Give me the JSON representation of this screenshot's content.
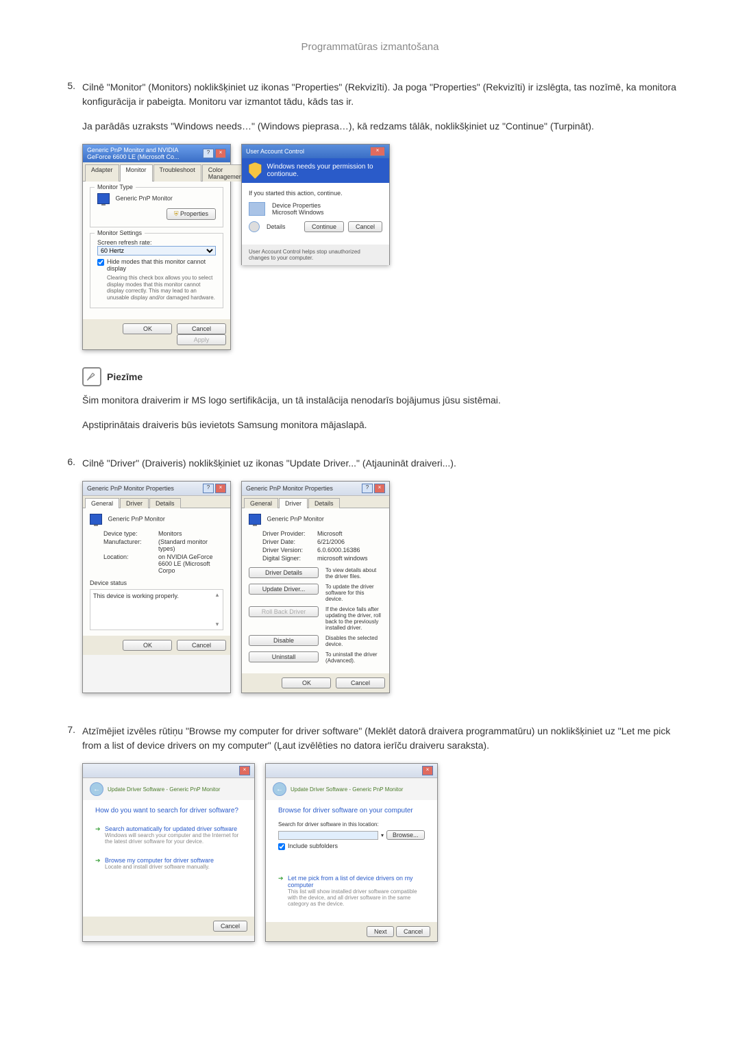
{
  "header": "Programmatūras izmantošana",
  "step5": {
    "num": "5.",
    "text1": "Cilnē \"Monitor\" (Monitors) noklikšķiniet uz ikonas \"Properties\" (Rekvizīti). Ja poga \"Properties\" (Rekvizīti) ir izslēgta, tas nozīmē, ka monitora konfigurācija ir pabeigta. Monitoru var izmantot tādu, kāds tas ir.",
    "text2": "Ja parādās uzraksts \"Windows needs…\" (Windows pieprasa…), kā redzams tālāk, noklikšķiniet uz \"Continue\" (Turpināt)."
  },
  "monprops": {
    "title": "Generic PnP Monitor and NVIDIA GeForce 6600 LE (Microsoft Co...",
    "tabs": {
      "adapter": "Adapter",
      "monitor": "Monitor",
      "troubleshoot": "Troubleshoot",
      "color": "Color Management"
    },
    "group_type": "Monitor Type",
    "type_name": "Generic PnP Monitor",
    "properties_btn": "Properties",
    "group_settings": "Monitor Settings",
    "refresh_label": "Screen refresh rate:",
    "refresh_val": "60 Hertz",
    "hide_chk": "Hide modes that this monitor cannot display",
    "hide_desc": "Clearing this check box allows you to select display modes that this monitor cannot display correctly. This may lead to an unusable display and/or damaged hardware.",
    "ok": "OK",
    "cancel": "Cancel",
    "apply": "Apply"
  },
  "uac": {
    "title": "User Account Control",
    "blue": "Windows needs your permission to contionue.",
    "started": "If you started this action, continue.",
    "dev_name": "Device Properties",
    "dev_pub": "Microsoft Windows",
    "details": "Details",
    "continue": "Continue",
    "cancel": "Cancel",
    "foot": "User Account Control helps stop unauthorized changes to your computer."
  },
  "note": {
    "label": "Piezīme",
    "text1": "Šim monitora draiverim ir MS logo sertifikācija, un tā instalācija nenodarīs bojājumus jūsu sistēmai.",
    "text2": "Apstiprinātais draiveris būs ievietots Samsung monitora mājaslapā."
  },
  "step6": {
    "num": "6.",
    "text": "Cilnē \"Driver\" (Draiveris) noklikšķiniet uz ikonas \"Update Driver...\" (Atjaunināt draiveri...)."
  },
  "devprops": {
    "title": "Generic PnP Monitor Properties",
    "tabs": {
      "general": "General",
      "driver": "Driver",
      "details": "Details"
    },
    "name": "Generic PnP Monitor",
    "devtype_l": "Device type:",
    "devtype_v": "Monitors",
    "mfr_l": "Manufacturer:",
    "mfr_v": "(Standard monitor types)",
    "loc_l": "Location:",
    "loc_v": "on NVIDIA GeForce 6600 LE (Microsoft Corpo",
    "status_l": "Device status",
    "status_v": "This device is working properly.",
    "ok": "OK",
    "cancel": "Cancel"
  },
  "drvtab": {
    "provider_l": "Driver Provider:",
    "provider_v": "Microsoft",
    "date_l": "Driver Date:",
    "date_v": "6/21/2006",
    "ver_l": "Driver Version:",
    "ver_v": "6.0.6000.16386",
    "signer_l": "Digital Signer:",
    "signer_v": "microsoft windows",
    "details_btn": "Driver Details",
    "details_desc": "To view details about the driver files.",
    "update_btn": "Update Driver...",
    "update_desc": "To update the driver software for this device.",
    "rollback_btn": "Roll Back Driver",
    "rollback_desc": "If the device fails after updating the driver, roll back to the previously installed driver.",
    "disable_btn": "Disable",
    "disable_desc": "Disables the selected device.",
    "uninstall_btn": "Uninstall",
    "uninstall_desc": "To uninstall the driver (Advanced).",
    "ok": "OK",
    "cancel": "Cancel"
  },
  "step7": {
    "num": "7.",
    "text": "Atzīmējiet izvēles rūtiņu \"Browse my computer for driver software\" (Meklēt datorā draivera programmatūru) un noklikšķiniet uz \"Let me pick from a list of device drivers on my computer\" (Ļaut izvēlēties no datora ierīču draiveru saraksta)."
  },
  "wiz1": {
    "path": "Update Driver Software - Generic PnP Monitor",
    "h": "How do you want to search for driver software?",
    "opt1": "Search automatically for updated driver software",
    "opt1d": "Windows will search your computer and the Internet for the latest driver software for your device.",
    "opt2": "Browse my computer for driver software",
    "opt2d": "Locate and install driver software manually.",
    "cancel": "Cancel"
  },
  "wiz2": {
    "path": "Update Driver Software - Generic PnP Monitor",
    "h": "Browse for driver software on your computer",
    "search_l": "Search for driver software in this location:",
    "browse": "Browse...",
    "include": "Include subfolders",
    "opt": "Let me pick from a list of device drivers on my computer",
    "optd": "This list will show installed driver software compatible with the device, and all driver software in the same category as the device.",
    "next": "Next",
    "cancel": "Cancel"
  }
}
